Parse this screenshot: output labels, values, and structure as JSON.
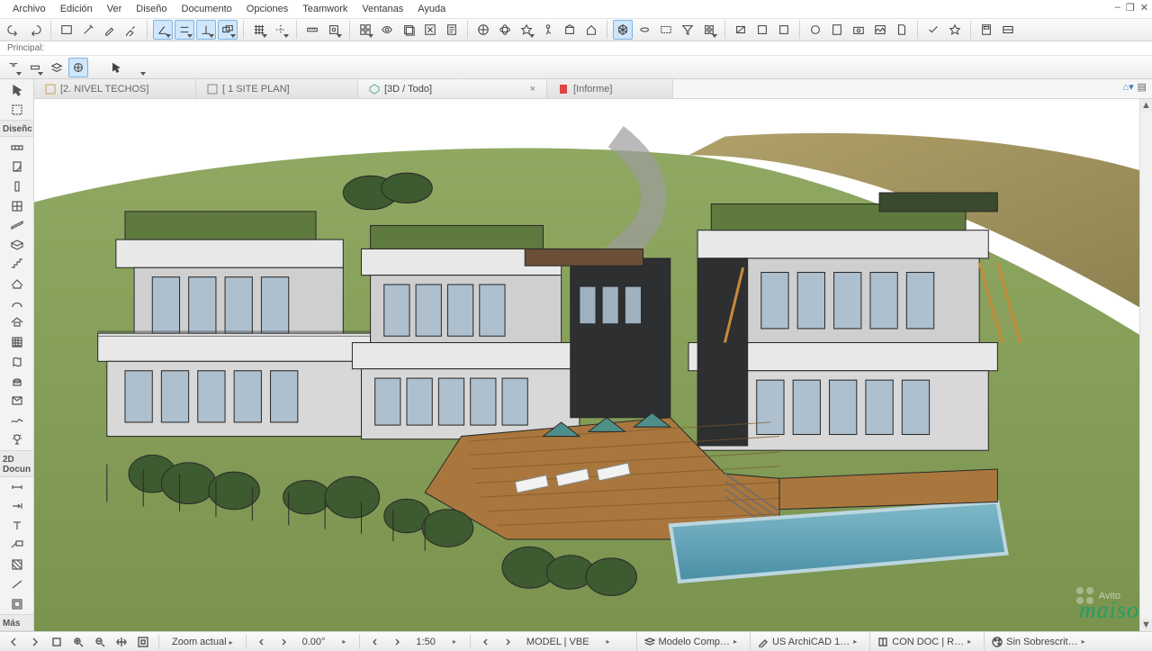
{
  "menu": {
    "items": [
      "Archivo",
      "Edición",
      "Ver",
      "Diseño",
      "Documento",
      "Opciones",
      "Teamwork",
      "Ventanas",
      "Ayuda"
    ]
  },
  "window_controls": [
    "–",
    "❐",
    "✕"
  ],
  "dock": {
    "label": "Principal:"
  },
  "tabs": {
    "items": [
      {
        "label": "[2. NIVEL TECHOS]",
        "kind": "plan",
        "active": false
      },
      {
        "label": "[ 1 SITE PLAN]",
        "kind": "plan",
        "active": false
      },
      {
        "label": "[3D / Todo]",
        "kind": "3d",
        "active": true
      },
      {
        "label": "[Informe]",
        "kind": "report",
        "active": false
      }
    ]
  },
  "left_toolbox": {
    "sections": [
      {
        "label": "",
        "tools": [
          "arrow",
          "marquee"
        ]
      },
      {
        "label": "Diseñc",
        "tools": [
          "wall",
          "wall-curve",
          "column",
          "slab",
          "beam",
          "window",
          "door",
          "skylight",
          "stair",
          "roof",
          "roof-poly",
          "mesh",
          "shell",
          "curtain",
          "morph",
          "object",
          "light"
        ]
      },
      {
        "label": "2D Docun",
        "tools": [
          "dimension",
          "level-dim",
          "text",
          "label",
          "fill",
          "line",
          "arc",
          "poly"
        ]
      },
      {
        "label": "Más",
        "tools": [
          "more"
        ]
      }
    ]
  },
  "statusbar": {
    "zoom_label": "Zoom actual",
    "angle": "0.00°",
    "scale": "1:50",
    "model_label": "MODEL | VBE",
    "chips": [
      {
        "icon": "layers",
        "label": "Modelo Comp…"
      },
      {
        "icon": "pen",
        "label": "US ArchiCAD 1…"
      },
      {
        "icon": "book",
        "label": "CON DOC | R…"
      },
      {
        "icon": "palette",
        "label": "Sin Sobrescrit…"
      }
    ]
  },
  "watermark": {
    "brand": "maiso",
    "overlay": "Avito"
  }
}
